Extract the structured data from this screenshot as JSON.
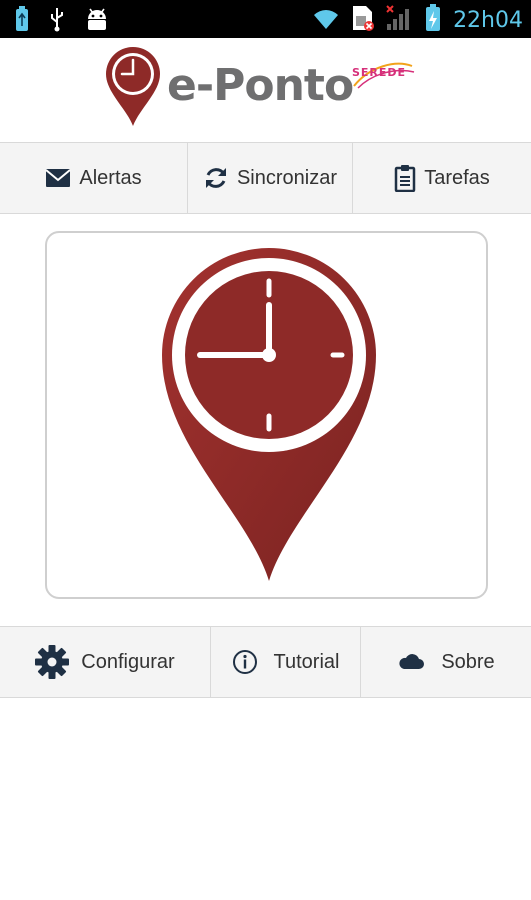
{
  "status_bar": {
    "time": "22h04",
    "left_icons": [
      "usb-battery-icon",
      "usb-icon",
      "android-debug-icon"
    ],
    "right_icons": [
      "wifi-icon",
      "sim-error-icon",
      "signal-no-service-icon",
      "battery-charging-icon"
    ]
  },
  "header": {
    "logo_text": "e-Ponto",
    "brand_text": "SEREDE"
  },
  "top_toolbar": [
    {
      "label": "Alertas",
      "icon": "mail-icon"
    },
    {
      "label": "Sincronizar",
      "icon": "sync-icon"
    },
    {
      "label": "Tarefas",
      "icon": "clipboard-icon"
    }
  ],
  "bottom_toolbar": [
    {
      "label": "Configurar",
      "icon": "gear-icon"
    },
    {
      "label": "Tutorial",
      "icon": "info-icon"
    },
    {
      "label": "Sobre",
      "icon": "cloud-icon"
    }
  ],
  "colors": {
    "brand_red": "#8e2a28",
    "logo_gray": "#6f6f70",
    "icon_navy": "#1f3044",
    "status_time": "#5fc8ea"
  }
}
